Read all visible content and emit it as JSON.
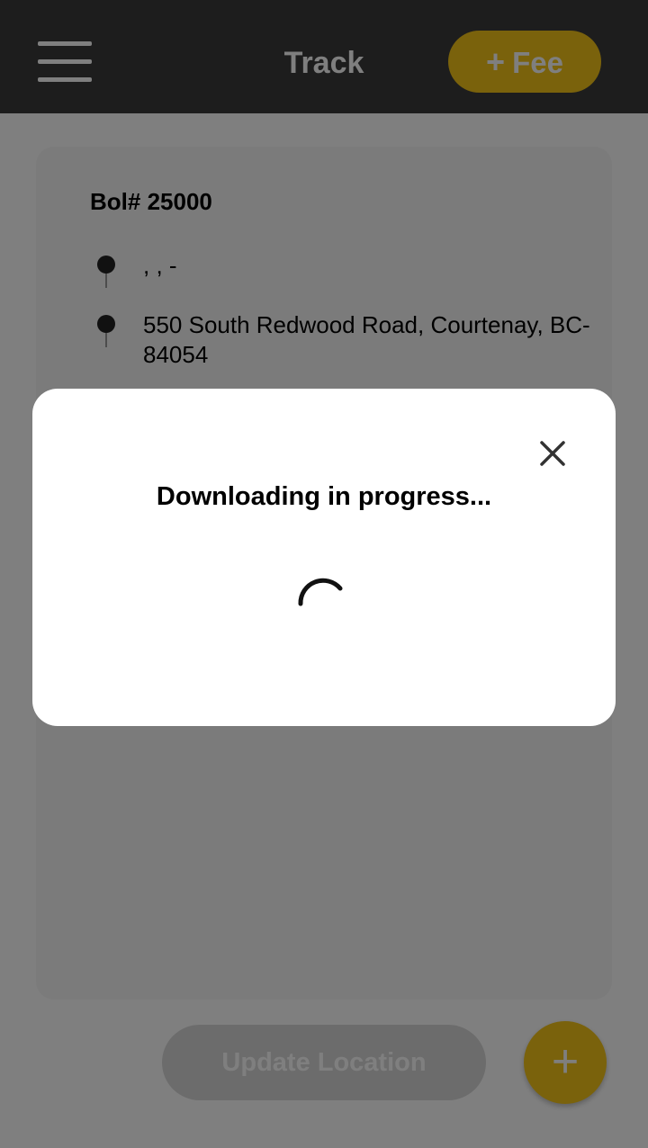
{
  "app_bar": {
    "title": "Track",
    "fee_button_label": "Fee",
    "fee_button_icon": "plus-icon",
    "menu_icon": "hamburger-menu-icon"
  },
  "card": {
    "bol_label": "Bol# 25000",
    "locations": [
      {
        "icon": "map-pin-icon",
        "text": ", , -"
      },
      {
        "icon": "map-pin-icon",
        "text": "550 South Redwood Road, Courtenay, BC-84054"
      }
    ]
  },
  "bottom": {
    "update_location_label": "Update Location",
    "fab_label": "+"
  },
  "dialog": {
    "message": "Downloading in progress...",
    "close_icon": "close-icon",
    "spinner_icon": "loading-spinner-icon"
  },
  "colors": {
    "app_bar_bg": "#3a3a3a",
    "accent": "#f5c518",
    "card_bg": "#f7f7f7",
    "disabled_button_bg": "#d9d9d9",
    "overlay": "rgba(0,0,0,0.5)"
  }
}
